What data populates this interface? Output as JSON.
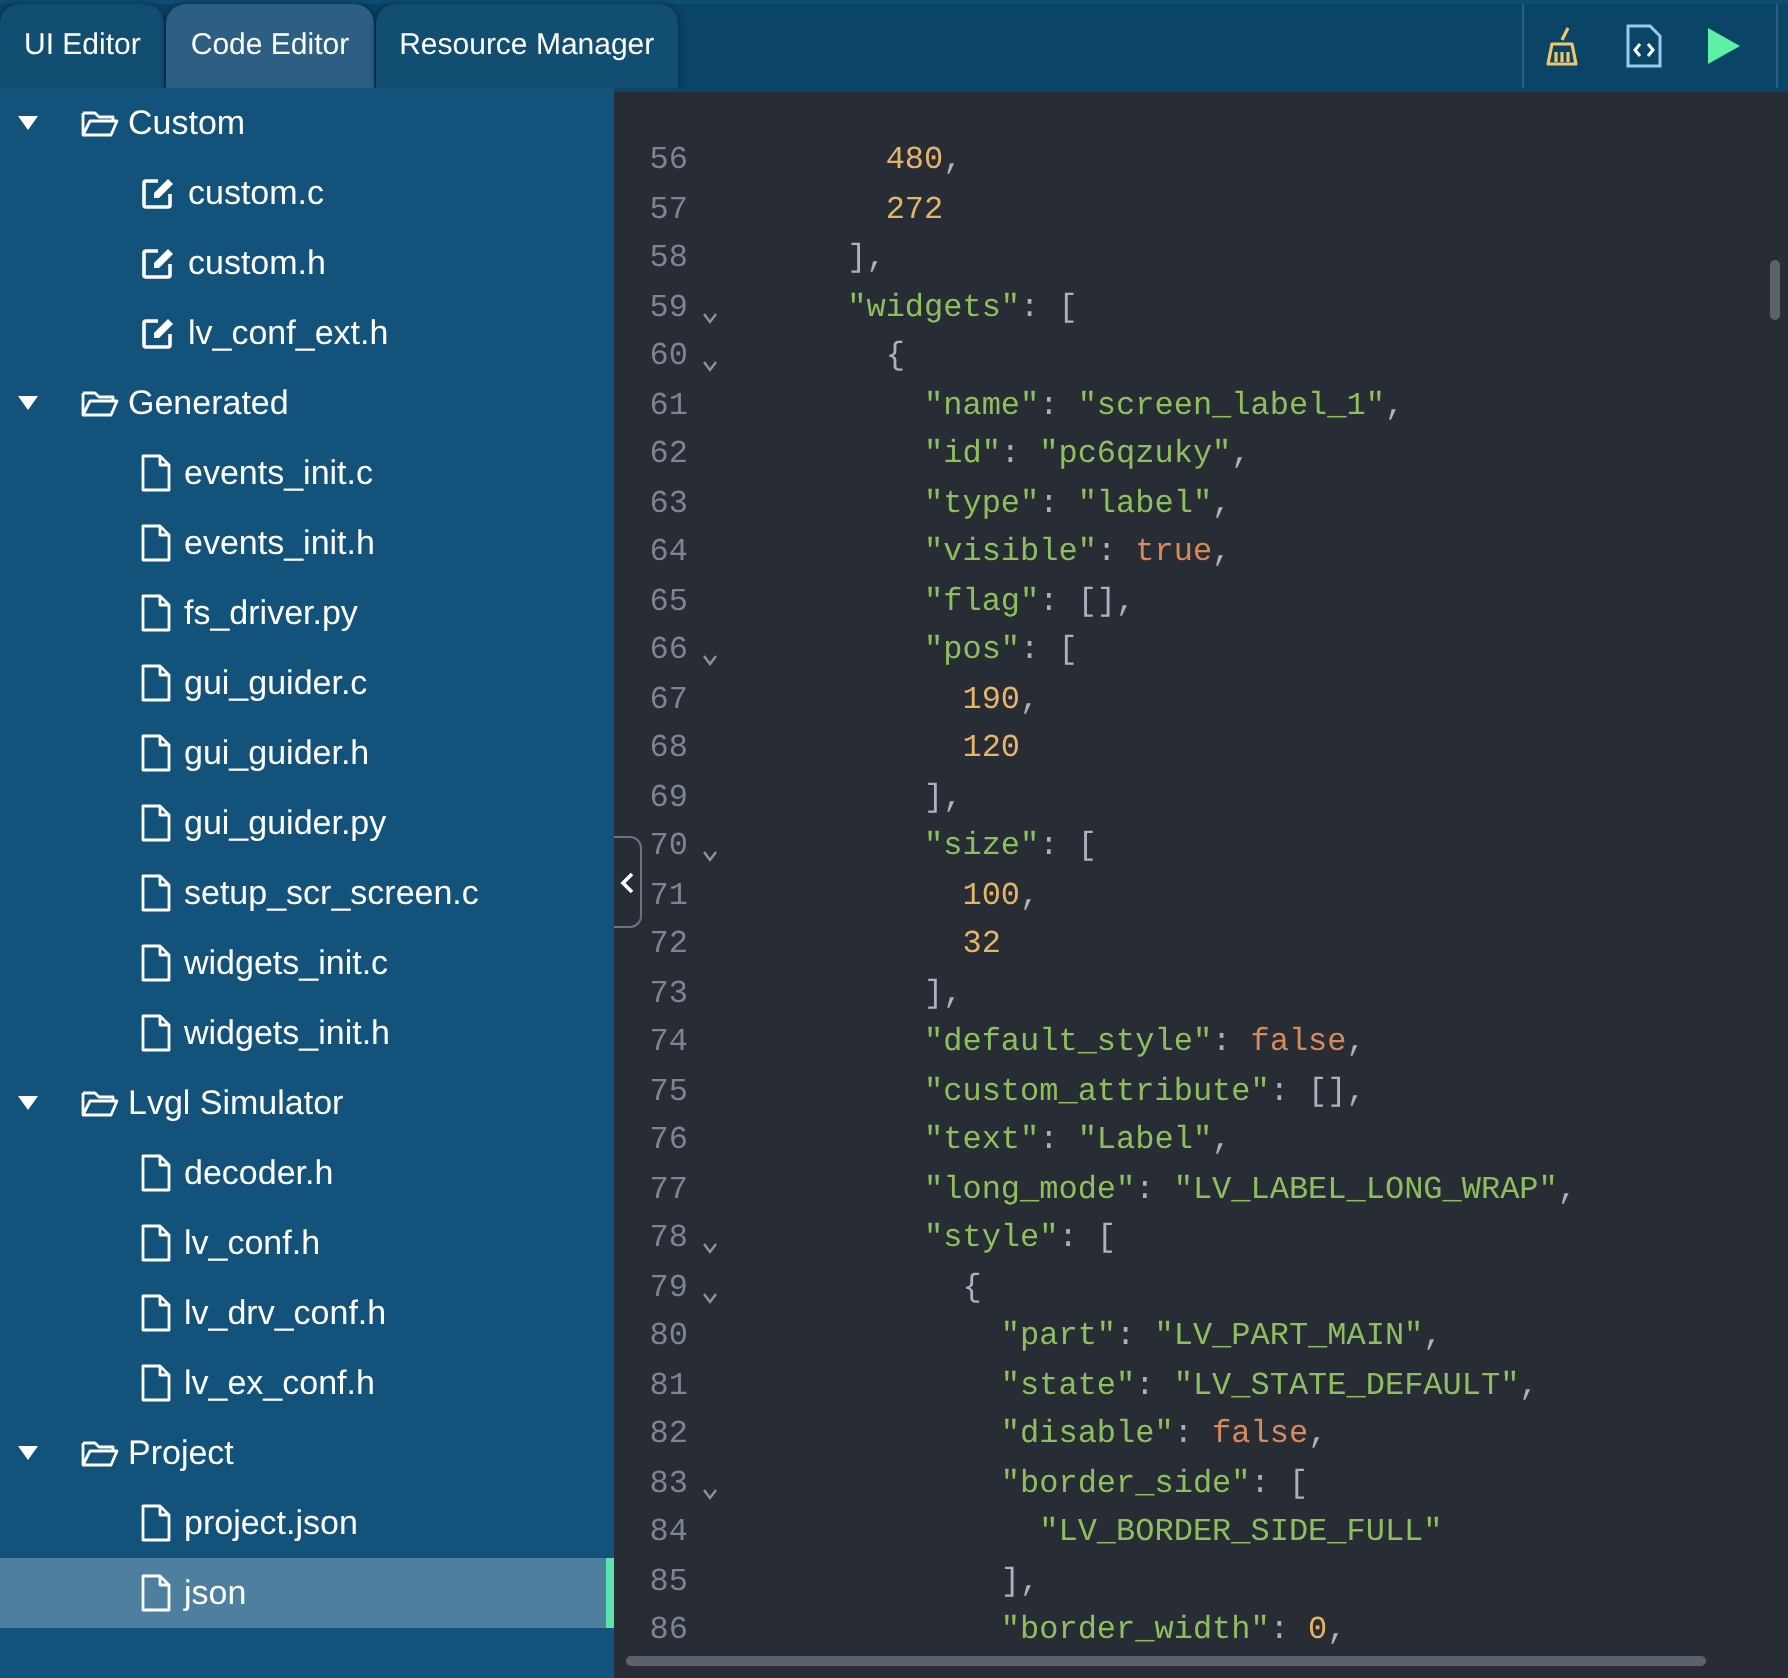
{
  "tabs": [
    {
      "label": "UI Editor",
      "selected": false
    },
    {
      "label": "Code Editor",
      "selected": true
    },
    {
      "label": "Resource Manager",
      "selected": false
    }
  ],
  "tree": [
    {
      "label": "Custom",
      "expanded": true,
      "children": [
        {
          "label": "custom.c",
          "kind": "edit",
          "selected": false
        },
        {
          "label": "custom.h",
          "kind": "edit",
          "selected": false
        },
        {
          "label": "lv_conf_ext.h",
          "kind": "edit",
          "selected": false
        }
      ]
    },
    {
      "label": "Generated",
      "expanded": true,
      "children": [
        {
          "label": "events_init.c",
          "kind": "file",
          "selected": false
        },
        {
          "label": "events_init.h",
          "kind": "file",
          "selected": false
        },
        {
          "label": "fs_driver.py",
          "kind": "file",
          "selected": false
        },
        {
          "label": "gui_guider.c",
          "kind": "file",
          "selected": false
        },
        {
          "label": "gui_guider.h",
          "kind": "file",
          "selected": false
        },
        {
          "label": "gui_guider.py",
          "kind": "file",
          "selected": false
        },
        {
          "label": "setup_scr_screen.c",
          "kind": "file",
          "selected": false
        },
        {
          "label": "widgets_init.c",
          "kind": "file",
          "selected": false
        },
        {
          "label": "widgets_init.h",
          "kind": "file",
          "selected": false
        }
      ]
    },
    {
      "label": "Lvgl Simulator",
      "expanded": true,
      "children": [
        {
          "label": "decoder.h",
          "kind": "file",
          "selected": false
        },
        {
          "label": "lv_conf.h",
          "kind": "file",
          "selected": false
        },
        {
          "label": "lv_drv_conf.h",
          "kind": "file",
          "selected": false
        },
        {
          "label": "lv_ex_conf.h",
          "kind": "file",
          "selected": false
        }
      ]
    },
    {
      "label": "Project",
      "expanded": true,
      "children": [
        {
          "label": "project.json",
          "kind": "file",
          "selected": false
        },
        {
          "label": "json",
          "kind": "file",
          "selected": true
        }
      ]
    }
  ],
  "code": {
    "lines": [
      {
        "n": "56",
        "fold": false,
        "tokens": [
          {
            "kind": "number",
            "t": "        480"
          },
          {
            "kind": "punct",
            "t": ","
          }
        ]
      },
      {
        "n": "57",
        "fold": false,
        "tokens": [
          {
            "kind": "number",
            "t": "        272"
          }
        ]
      },
      {
        "n": "58",
        "fold": false,
        "tokens": [
          {
            "kind": "punct",
            "t": "      ],"
          }
        ]
      },
      {
        "n": "59",
        "fold": true,
        "tokens": [
          {
            "kind": "key",
            "t": "      \"widgets\""
          },
          {
            "kind": "punct",
            "t": ": ["
          }
        ]
      },
      {
        "n": "60",
        "fold": true,
        "tokens": [
          {
            "kind": "punct",
            "t": "        {"
          }
        ]
      },
      {
        "n": "61",
        "fold": false,
        "tokens": [
          {
            "kind": "key",
            "t": "          \"name\""
          },
          {
            "kind": "punct",
            "t": ": "
          },
          {
            "kind": "string",
            "t": "\"screen_label_1\""
          },
          {
            "kind": "punct",
            "t": ","
          }
        ]
      },
      {
        "n": "62",
        "fold": false,
        "tokens": [
          {
            "kind": "key",
            "t": "          \"id\""
          },
          {
            "kind": "punct",
            "t": ": "
          },
          {
            "kind": "string",
            "t": "\"pc6qzuky\""
          },
          {
            "kind": "punct",
            "t": ","
          }
        ]
      },
      {
        "n": "63",
        "fold": false,
        "tokens": [
          {
            "kind": "key",
            "t": "          \"type\""
          },
          {
            "kind": "punct",
            "t": ": "
          },
          {
            "kind": "string",
            "t": "\"label\""
          },
          {
            "kind": "punct",
            "t": ","
          }
        ]
      },
      {
        "n": "64",
        "fold": false,
        "tokens": [
          {
            "kind": "key",
            "t": "          \"visible\""
          },
          {
            "kind": "punct",
            "t": ": "
          },
          {
            "kind": "bool",
            "t": "true"
          },
          {
            "kind": "punct",
            "t": ","
          }
        ]
      },
      {
        "n": "65",
        "fold": false,
        "tokens": [
          {
            "kind": "key",
            "t": "          \"flag\""
          },
          {
            "kind": "punct",
            "t": ": [],"
          }
        ]
      },
      {
        "n": "66",
        "fold": true,
        "tokens": [
          {
            "kind": "key",
            "t": "          \"pos\""
          },
          {
            "kind": "punct",
            "t": ": ["
          }
        ]
      },
      {
        "n": "67",
        "fold": false,
        "tokens": [
          {
            "kind": "number",
            "t": "            190"
          },
          {
            "kind": "punct",
            "t": ","
          }
        ]
      },
      {
        "n": "68",
        "fold": false,
        "tokens": [
          {
            "kind": "number",
            "t": "            120"
          }
        ]
      },
      {
        "n": "69",
        "fold": false,
        "tokens": [
          {
            "kind": "punct",
            "t": "          ],"
          }
        ]
      },
      {
        "n": "70",
        "fold": true,
        "tokens": [
          {
            "kind": "key",
            "t": "          \"size\""
          },
          {
            "kind": "punct",
            "t": ": ["
          }
        ]
      },
      {
        "n": "71",
        "fold": false,
        "tokens": [
          {
            "kind": "number",
            "t": "            100"
          },
          {
            "kind": "punct",
            "t": ","
          }
        ]
      },
      {
        "n": "72",
        "fold": false,
        "tokens": [
          {
            "kind": "number",
            "t": "            32"
          }
        ]
      },
      {
        "n": "73",
        "fold": false,
        "tokens": [
          {
            "kind": "punct",
            "t": "          ],"
          }
        ]
      },
      {
        "n": "74",
        "fold": false,
        "tokens": [
          {
            "kind": "key",
            "t": "          \"default_style\""
          },
          {
            "kind": "punct",
            "t": ": "
          },
          {
            "kind": "bool",
            "t": "false"
          },
          {
            "kind": "punct",
            "t": ","
          }
        ]
      },
      {
        "n": "75",
        "fold": false,
        "tokens": [
          {
            "kind": "key",
            "t": "          \"custom_attribute\""
          },
          {
            "kind": "punct",
            "t": ": [],"
          }
        ]
      },
      {
        "n": "76",
        "fold": false,
        "tokens": [
          {
            "kind": "key",
            "t": "          \"text\""
          },
          {
            "kind": "punct",
            "t": ": "
          },
          {
            "kind": "string",
            "t": "\"Label\""
          },
          {
            "kind": "punct",
            "t": ","
          }
        ]
      },
      {
        "n": "77",
        "fold": false,
        "tokens": [
          {
            "kind": "key",
            "t": "          \"long_mode\""
          },
          {
            "kind": "punct",
            "t": ": "
          },
          {
            "kind": "string",
            "t": "\"LV_LABEL_LONG_WRAP\""
          },
          {
            "kind": "punct",
            "t": ","
          }
        ]
      },
      {
        "n": "78",
        "fold": true,
        "tokens": [
          {
            "kind": "key",
            "t": "          \"style\""
          },
          {
            "kind": "punct",
            "t": ": ["
          }
        ]
      },
      {
        "n": "79",
        "fold": true,
        "tokens": [
          {
            "kind": "punct",
            "t": "            {"
          }
        ]
      },
      {
        "n": "80",
        "fold": false,
        "tokens": [
          {
            "kind": "key",
            "t": "              \"part\""
          },
          {
            "kind": "punct",
            "t": ": "
          },
          {
            "kind": "string",
            "t": "\"LV_PART_MAIN\""
          },
          {
            "kind": "punct",
            "t": ","
          }
        ]
      },
      {
        "n": "81",
        "fold": false,
        "tokens": [
          {
            "kind": "key",
            "t": "              \"state\""
          },
          {
            "kind": "punct",
            "t": ": "
          },
          {
            "kind": "string",
            "t": "\"LV_STATE_DEFAULT\""
          },
          {
            "kind": "punct",
            "t": ","
          }
        ]
      },
      {
        "n": "82",
        "fold": false,
        "tokens": [
          {
            "kind": "key",
            "t": "              \"disable\""
          },
          {
            "kind": "punct",
            "t": ": "
          },
          {
            "kind": "bool",
            "t": "false"
          },
          {
            "kind": "punct",
            "t": ","
          }
        ]
      },
      {
        "n": "83",
        "fold": true,
        "tokens": [
          {
            "kind": "key",
            "t": "              \"border_side\""
          },
          {
            "kind": "punct",
            "t": ": ["
          }
        ]
      },
      {
        "n": "84",
        "fold": false,
        "tokens": [
          {
            "kind": "string",
            "t": "                \"LV_BORDER_SIDE_FULL\""
          }
        ]
      },
      {
        "n": "85",
        "fold": false,
        "tokens": [
          {
            "kind": "punct",
            "t": "              ],"
          }
        ]
      },
      {
        "n": "86",
        "fold": false,
        "tokens": [
          {
            "kind": "key",
            "t": "              \"border_width\""
          },
          {
            "kind": "punct",
            "t": ": "
          },
          {
            "kind": "number",
            "t": "0"
          },
          {
            "kind": "punct",
            "t": ","
          }
        ]
      }
    ]
  }
}
